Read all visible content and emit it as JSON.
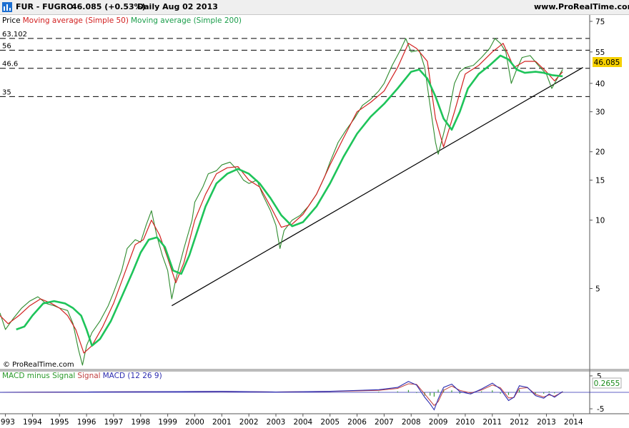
{
  "header": {
    "instrument": "FUR - FUGRO",
    "price_change": "46.085 (+0.53%)",
    "period_date": "Daily  Aug 02 2013",
    "website": "www.ProRealTime.com"
  },
  "copyright": "© ProRealTime.com",
  "colors": {
    "price": "#2e8b2e",
    "sma50": "#d22020",
    "sma200": "#1ec45a",
    "macd_signal": "#c04040",
    "macd_line": "#2c2cb0",
    "macd_hist": "#3a9c3a",
    "price_badge": "#f6d000",
    "macd_badge_text": "#1a8a1a"
  },
  "chart_data": [
    {
      "type": "line",
      "scale": "log",
      "legend": {
        "price": "Price",
        "sma50": "Moving average (Simple 50)",
        "sma200": "Moving average (Simple 200)"
      },
      "y_ticks": [
        5,
        10,
        15,
        20,
        30,
        40,
        55,
        75
      ],
      "x_labels": [
        "1993",
        "1994",
        "1995",
        "1996",
        "1997",
        "1998",
        "1999",
        "2000",
        "2001",
        "2002",
        "2003",
        "2004",
        "2005",
        "2006",
        "2007",
        "2008",
        "2009",
        "2010",
        "2011",
        "2012",
        "2013",
        "2014"
      ],
      "ylim": [
        2.2,
        80
      ],
      "xlim": [
        1992.8,
        2014.6
      ],
      "last_price": "46.085",
      "horizontal_levels": [
        {
          "label": "63.102",
          "value": 63.102
        },
        {
          "label": "56",
          "value": 56
        },
        {
          "label": "46.6",
          "value": 46.6
        },
        {
          "label": "35",
          "value": 35
        }
      ],
      "trendline": {
        "from": [
          1999.15,
          4.2
        ],
        "to": [
          2014.35,
          47
        ]
      },
      "series": [
        {
          "name": "Price",
          "x": [
            1992.8,
            1993.0,
            1993.3,
            1993.6,
            1993.9,
            1994.2,
            1994.5,
            1994.8,
            1995.0,
            1995.3,
            1995.5,
            1995.7,
            1995.85,
            1996.0,
            1996.2,
            1996.5,
            1996.8,
            1997.0,
            1997.3,
            1997.5,
            1997.8,
            1998.0,
            1998.2,
            1998.4,
            1998.6,
            1998.8,
            1999.0,
            1999.15,
            1999.3,
            1999.6,
            1999.9,
            2000.0,
            2000.3,
            2000.5,
            2000.8,
            2001.0,
            2001.3,
            2001.5,
            2001.8,
            2002.0,
            2002.3,
            2002.5,
            2002.8,
            2003.0,
            2003.15,
            2003.3,
            2003.6,
            2003.9,
            2004.2,
            2004.5,
            2004.8,
            2005.0,
            2005.3,
            2005.6,
            2005.9,
            2006.2,
            2006.5,
            2006.8,
            2007.0,
            2007.3,
            2007.6,
            2007.8,
            2008.0,
            2008.3,
            2008.5,
            2008.7,
            2008.9,
            2009.0,
            2009.2,
            2009.4,
            2009.6,
            2009.8,
            2010.0,
            2010.3,
            2010.6,
            2010.9,
            2011.1,
            2011.3,
            2011.5,
            2011.7,
            2011.9,
            2012.1,
            2012.4,
            2012.7,
            2013.0,
            2013.2,
            2013.4,
            2013.6
          ],
          "values": [
            3.9,
            3.3,
            3.7,
            4.1,
            4.4,
            4.6,
            4.3,
            4.2,
            4.1,
            4.0,
            3.5,
            2.7,
            2.3,
            2.8,
            3.2,
            3.6,
            4.2,
            4.8,
            6.0,
            7.5,
            8.2,
            8.0,
            9.5,
            11.0,
            8.5,
            7.0,
            6.0,
            4.5,
            5.5,
            7.5,
            10.0,
            12.0,
            14.0,
            16.0,
            16.5,
            17.5,
            18.0,
            17.0,
            15.0,
            14.5,
            15.0,
            13.0,
            11.0,
            9.5,
            7.5,
            9.0,
            10.0,
            10.5,
            11.5,
            13.0,
            15.5,
            18.0,
            22.0,
            25.0,
            28.0,
            32.0,
            34.0,
            37.0,
            40.0,
            48.0,
            56.0,
            63.0,
            55.0,
            56.0,
            47.0,
            32.0,
            22.0,
            19.5,
            24.0,
            30.0,
            40.0,
            45.0,
            47.0,
            48.0,
            52.0,
            57.0,
            63.0,
            60.0,
            55.0,
            40.0,
            46.0,
            52.0,
            53.0,
            48.0,
            44.0,
            38.0,
            42.0,
            46.085
          ]
        },
        {
          "name": "Moving average (Simple 50)",
          "x": [
            1992.8,
            1993.1,
            1993.5,
            1993.9,
            1994.3,
            1994.7,
            1995.0,
            1995.3,
            1995.6,
            1995.9,
            1996.2,
            1996.6,
            1997.0,
            1997.4,
            1997.8,
            1998.1,
            1998.4,
            1998.7,
            1999.0,
            1999.3,
            1999.6,
            2000.0,
            2000.4,
            2000.8,
            2001.2,
            2001.6,
            2002.0,
            2002.4,
            2002.8,
            2003.2,
            2003.6,
            2004.0,
            2004.5,
            2005.0,
            2005.5,
            2006.0,
            2006.5,
            2007.0,
            2007.5,
            2007.9,
            2008.2,
            2008.6,
            2008.9,
            2009.2,
            2009.6,
            2010.0,
            2010.5,
            2011.0,
            2011.4,
            2011.8,
            2012.2,
            2012.6,
            2013.0,
            2013.3,
            2013.6
          ],
          "values": [
            3.8,
            3.5,
            3.8,
            4.2,
            4.5,
            4.3,
            4.1,
            3.8,
            3.3,
            2.6,
            2.8,
            3.4,
            4.3,
            5.8,
            7.8,
            8.2,
            10.0,
            8.6,
            6.8,
            5.3,
            6.5,
            10.0,
            13.0,
            16.0,
            17.0,
            17.2,
            15.0,
            14.0,
            11.5,
            9.3,
            9.6,
            10.6,
            13.0,
            17.5,
            23.0,
            30.0,
            33.0,
            37.0,
            47.0,
            60.0,
            57.0,
            50.0,
            28.0,
            21.0,
            30.0,
            44.0,
            48.0,
            55.0,
            60.0,
            47.0,
            50.0,
            50.0,
            45.0,
            41.0,
            45.0
          ]
        },
        {
          "name": "Moving average (Simple 200)",
          "x": [
            1993.4,
            1993.7,
            1994.0,
            1994.4,
            1994.8,
            1995.2,
            1995.5,
            1995.8,
            1996.0,
            1996.2,
            1996.5,
            1996.9,
            1997.3,
            1997.7,
            1998.0,
            1998.3,
            1998.6,
            1998.9,
            1999.2,
            1999.5,
            1999.8,
            2000.1,
            2000.4,
            2000.8,
            2001.2,
            2001.6,
            2002.0,
            2002.4,
            2002.8,
            2003.2,
            2003.6,
            2004.0,
            2004.5,
            2005.0,
            2005.5,
            2006.0,
            2006.5,
            2007.0,
            2007.5,
            2008.0,
            2008.3,
            2008.6,
            2008.9,
            2009.2,
            2009.5,
            2009.8,
            2010.1,
            2010.5,
            2010.9,
            2011.3,
            2011.6,
            2011.9,
            2012.2,
            2012.6,
            2012.9,
            2013.2,
            2013.6
          ],
          "values": [
            3.3,
            3.4,
            3.8,
            4.3,
            4.4,
            4.3,
            4.1,
            3.8,
            3.3,
            2.8,
            3.0,
            3.6,
            4.6,
            5.9,
            7.2,
            8.2,
            8.4,
            7.6,
            6.0,
            5.8,
            7.0,
            9.0,
            11.5,
            14.5,
            16.0,
            16.8,
            16.0,
            14.5,
            12.5,
            10.5,
            9.4,
            9.8,
            11.5,
            14.5,
            19.0,
            24.0,
            28.5,
            32.5,
            38.0,
            45.0,
            46.0,
            42.0,
            35.0,
            28.0,
            25.0,
            30.0,
            38.0,
            44.0,
            48.0,
            53.0,
            51.0,
            46.0,
            44.5,
            45.0,
            44.5,
            43.5,
            43.0
          ]
        }
      ]
    },
    {
      "type": "line",
      "legend": {
        "hist": "MACD minus Signal",
        "signal": "Signal",
        "macd": "MACD (12 26 9)"
      },
      "y_ticks": [
        5,
        -5
      ],
      "last_value": "0.2655",
      "ylim": [
        -6.5,
        6.5
      ],
      "series": [
        {
          "name": "MACD (12 26 9)",
          "x": [
            1992.8,
            1996.0,
            1998.5,
            2001.0,
            2003.0,
            2005.0,
            2006.8,
            2007.5,
            2007.9,
            2008.2,
            2008.5,
            2008.7,
            2008.85,
            2009.0,
            2009.2,
            2009.5,
            2009.8,
            2010.2,
            2010.6,
            2011.0,
            2011.3,
            2011.6,
            2011.8,
            2012.0,
            2012.3,
            2012.6,
            2012.9,
            2013.1,
            2013.3,
            2013.6
          ],
          "values": [
            0,
            0.1,
            0.2,
            0.3,
            0.1,
            0.3,
            0.8,
            1.5,
            3.3,
            2.2,
            -1.5,
            -3.5,
            -5.3,
            -2.0,
            1.5,
            2.5,
            0.2,
            -0.5,
            1.0,
            2.8,
            1.0,
            -2.5,
            -1.5,
            2.0,
            1.5,
            -1.0,
            -1.8,
            -0.5,
            -1.5,
            0.27
          ]
        },
        {
          "name": "Signal",
          "x": [
            1992.8,
            1996.0,
            1998.5,
            2001.0,
            2003.0,
            2005.0,
            2006.8,
            2007.5,
            2007.9,
            2008.2,
            2008.5,
            2008.7,
            2008.85,
            2009.0,
            2009.2,
            2009.5,
            2009.8,
            2010.2,
            2010.6,
            2011.0,
            2011.3,
            2011.6,
            2011.8,
            2012.0,
            2012.3,
            2012.6,
            2012.9,
            2013.1,
            2013.3,
            2013.6
          ],
          "values": [
            0,
            0.1,
            0.2,
            0.25,
            0.1,
            0.25,
            0.6,
            1.2,
            2.6,
            2.4,
            -0.5,
            -2.5,
            -4.0,
            -2.8,
            0.6,
            1.9,
            0.6,
            -0.2,
            0.7,
            2.2,
            1.4,
            -1.7,
            -1.6,
            1.2,
            1.4,
            -0.6,
            -1.4,
            -0.8,
            -1.2,
            0.1
          ]
        }
      ]
    }
  ]
}
